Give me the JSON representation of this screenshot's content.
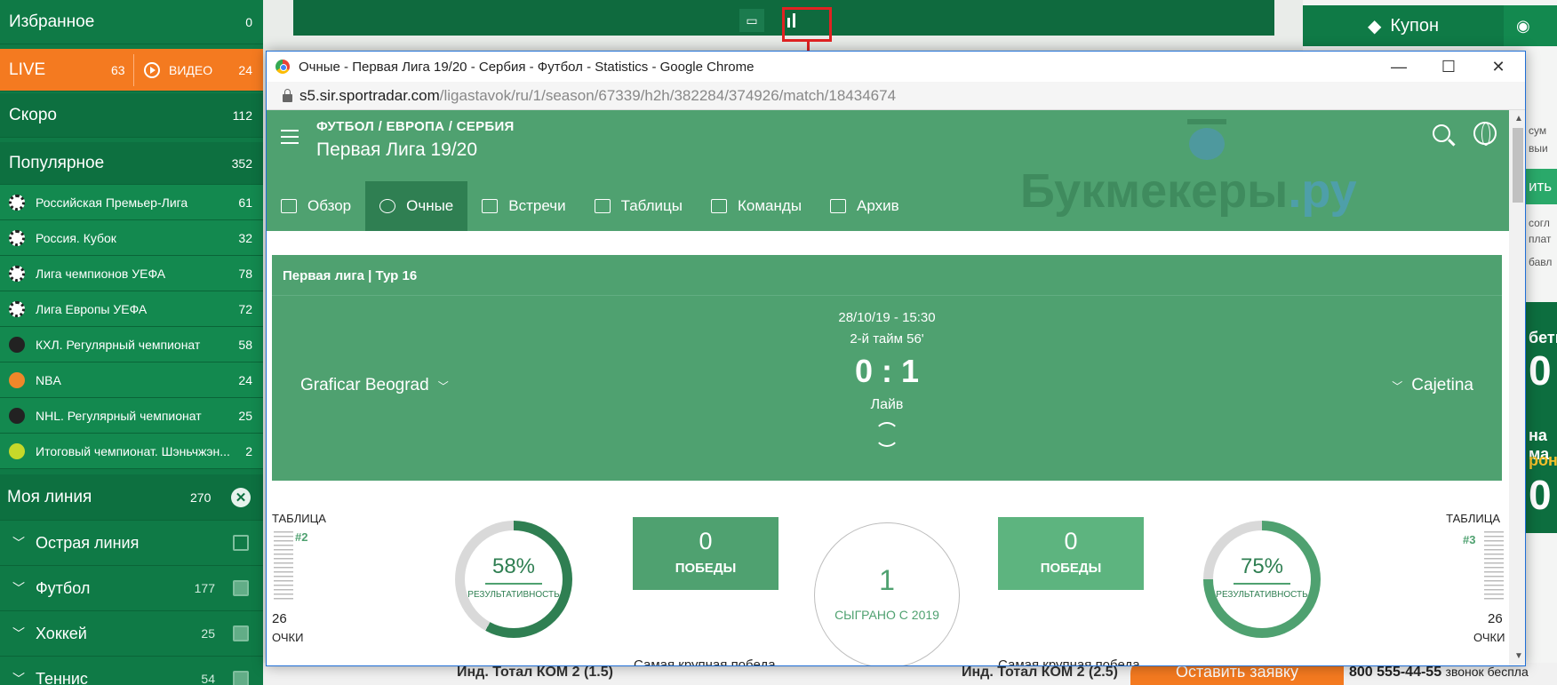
{
  "sidebar": {
    "favorites": {
      "label": "Избранное",
      "count": "0"
    },
    "live": {
      "label": "LIVE",
      "count": "63",
      "video_label": "ВИДЕО",
      "video_count": "24"
    },
    "soon": {
      "label": "Скоро",
      "count": "112"
    },
    "popular": {
      "label": "Популярное",
      "count": "352"
    },
    "sports": [
      {
        "label": "Российская Премьер-Лига",
        "count": "61",
        "icon": "football-icon"
      },
      {
        "label": "Россия. Кубок",
        "count": "32",
        "icon": "football-icon"
      },
      {
        "label": "Лига чемпионов УЕФА",
        "count": "78",
        "icon": "football-icon"
      },
      {
        "label": "Лига Европы УЕФА",
        "count": "72",
        "icon": "football-icon"
      },
      {
        "label": "КХЛ. Регулярный чемпионат",
        "count": "58",
        "icon": "hockey-puck-icon"
      },
      {
        "label": "NBA",
        "count": "24",
        "icon": "basketball-icon"
      },
      {
        "label": "NHL. Регулярный чемпионат",
        "count": "25",
        "icon": "hockey-puck-icon"
      },
      {
        "label": "Итоговый чемпионат. Шэньчжэн...",
        "count": "2",
        "icon": "tennis-ball-icon"
      }
    ],
    "my_line": {
      "label": "Моя линия",
      "count": "270"
    },
    "sub": [
      {
        "label": "Острая линия",
        "count": ""
      },
      {
        "label": "Футбол",
        "count": "177"
      },
      {
        "label": "Хоккей",
        "count": "25"
      },
      {
        "label": "Теннис",
        "count": "54"
      }
    ]
  },
  "right_panel": {
    "coupon_label": "Купон",
    "partial_texts": [
      "сум",
      "выи",
      "ить",
      "согл",
      "плат",
      "бавл",
      "бетн",
      "0",
      "на ма",
      "ронд",
      "0"
    ]
  },
  "bottom": {
    "left_bet": "Инд. Тотал КОМ 2 (1.5)",
    "right_bet": "Инд. Тотал КОМ 2 (2.5)",
    "leave_request": "Оставить заявку",
    "phone": "800 555-44-55",
    "phone_note": "звонок беспла"
  },
  "window": {
    "title": "Очные - Первая Лига 19/20 - Сербия - Футбол - Statistics - Google Chrome",
    "url_host": "s5.sir.sportradar.com",
    "url_path": "/ligastavok/ru/1/season/67339/h2h/382284/374926/match/18434674",
    "breadcrumb": "ФУТБОЛ / ЕВРОПА / СЕРБИЯ",
    "league": "Первая Лига 19/20",
    "watermark": "Букмекеры",
    "watermark_suffix": ".ру",
    "tabs": [
      {
        "label": "Обзор",
        "active": false
      },
      {
        "label": "Очные",
        "active": true
      },
      {
        "label": "Встречи",
        "active": false
      },
      {
        "label": "Таблицы",
        "active": false
      },
      {
        "label": "Команды",
        "active": false
      },
      {
        "label": "Архив",
        "active": false
      }
    ],
    "match": {
      "round": "Первая лига | Тур 16",
      "datetime": "28/10/19 - 15:30",
      "half": "2-й тайм  56'",
      "score": "0 : 1",
      "state": "Лайв",
      "home": "Graficar Beograd",
      "away": "Cajetina"
    },
    "stats": {
      "table_label": "ТАБЛИЦА",
      "home_rank": "#2",
      "away_rank": "#3",
      "home_points": "26",
      "away_points": "26",
      "points_label": "ОЧКИ",
      "home_eff": "58%",
      "away_eff": "75%",
      "eff_label": "РЕЗУЛЬТАТИВНОСТЬ",
      "home_eff_value": 58,
      "away_eff_value": 75,
      "home_wins": "0",
      "away_wins": "0",
      "wins_label": "ПОБЕДЫ",
      "played": "1",
      "played_label": "СЫГРАНО С 2019",
      "biggest_win_label": "Самая крупная победа"
    }
  },
  "colors": {
    "sidebar_green": "#0f7a46",
    "live_orange": "#f47a20",
    "page_green": "#4fa170",
    "active_tab": "#2f7f52",
    "highlight_red": "#e22222"
  }
}
